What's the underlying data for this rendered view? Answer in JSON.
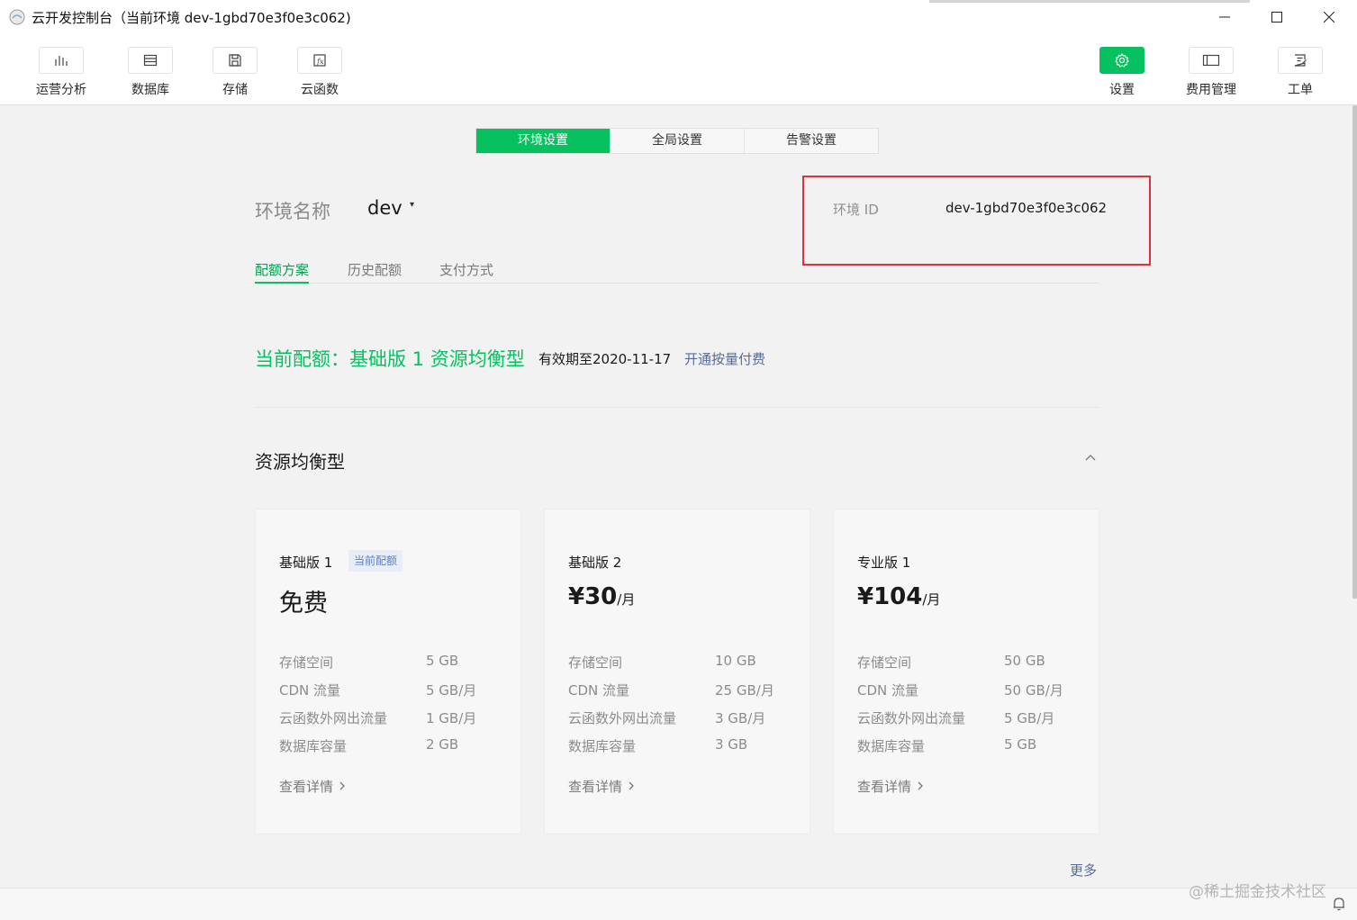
{
  "window": {
    "title": "云开发控制台（当前环境 dev-1gbd70e3f0e3c062)",
    "controls": {
      "minimize": "minimize-icon",
      "maximize": "maximize-icon",
      "close": "close-icon"
    }
  },
  "toolbar": {
    "left": [
      {
        "label": "运营分析",
        "icon": "bar-chart-icon"
      },
      {
        "label": "数据库",
        "icon": "database-icon"
      },
      {
        "label": "存储",
        "icon": "save-icon"
      },
      {
        "label": "云函数",
        "icon": "function-icon"
      }
    ],
    "right": [
      {
        "label": "设置",
        "icon": "gear-icon",
        "active": true
      },
      {
        "label": "费用管理",
        "icon": "wallet-icon"
      },
      {
        "label": "工单",
        "icon": "ticket-icon"
      }
    ]
  },
  "tabs": [
    "环境设置",
    "全局设置",
    "告警设置"
  ],
  "env": {
    "name_label": "环境名称",
    "name_value": "dev",
    "caret": "▾",
    "id_label": "环境 ID",
    "id_value": "dev-1gbd70e3f0e3c062"
  },
  "subtabs": [
    "配额方案",
    "历史配额",
    "支付方式"
  ],
  "quota": {
    "current": "当前配额：基础版 1 资源均衡型",
    "expires": "有效期至2020-11-17",
    "link": "开通按量付费"
  },
  "section": {
    "title": "资源均衡型"
  },
  "plans": [
    {
      "name": "基础版 1",
      "badge": "当前配额",
      "price": "免费",
      "unit": "",
      "specs": [
        {
          "k": "存储空间",
          "v": "5 GB"
        },
        {
          "k": "CDN 流量",
          "v": "5 GB/月"
        },
        {
          "k": "云函数外网出流量",
          "v": "1 GB/月"
        },
        {
          "k": "数据库容量",
          "v": "2 GB"
        }
      ],
      "detail": "查看详情"
    },
    {
      "name": "基础版 2",
      "badge": "",
      "price": "¥30",
      "unit": "/月",
      "specs": [
        {
          "k": "存储空间",
          "v": "10 GB"
        },
        {
          "k": "CDN 流量",
          "v": "25 GB/月"
        },
        {
          "k": "云函数外网出流量",
          "v": "3 GB/月"
        },
        {
          "k": "数据库容量",
          "v": "3 GB"
        }
      ],
      "detail": "查看详情"
    },
    {
      "name": "专业版 1",
      "badge": "",
      "price": "¥104",
      "unit": "/月",
      "specs": [
        {
          "k": "存储空间",
          "v": "50 GB"
        },
        {
          "k": "CDN 流量",
          "v": "50 GB/月"
        },
        {
          "k": "云函数外网出流量",
          "v": "5 GB/月"
        },
        {
          "k": "数据库容量",
          "v": "5 GB"
        }
      ],
      "detail": "查看详情"
    }
  ],
  "more": "更多",
  "watermark": "@稀土掘金技术社区",
  "colors": {
    "accent": "#07c160",
    "link": "#576b95",
    "highlight_border": "#e0323c"
  }
}
